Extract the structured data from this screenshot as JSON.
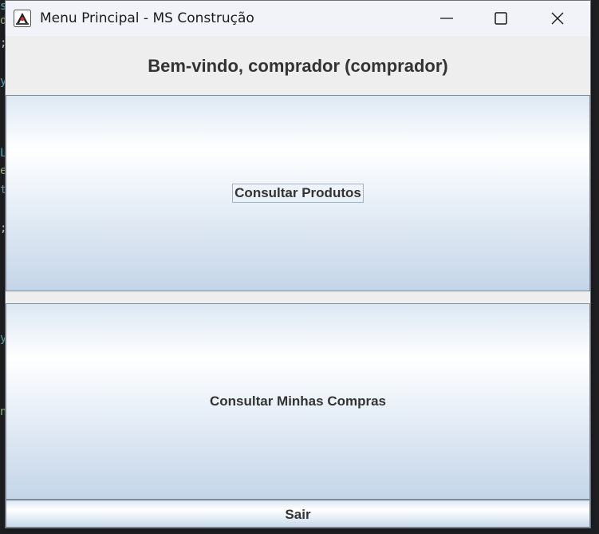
{
  "window": {
    "title": "Menu Principal - MS Construção",
    "app_icon": "java-duke-icon",
    "controls": [
      "minimize-icon",
      "maximize-icon",
      "close-icon"
    ]
  },
  "header": {
    "welcome_text": "Bem-vindo, comprador (comprador)"
  },
  "buttons": {
    "consultar_produtos": "Consultar Produtos",
    "consultar_compras": "Consultar Minhas Compras",
    "sair": "Sair"
  },
  "colors": {
    "button_gradient_top": "#ffffff",
    "button_gradient_bottom": "#c4d5e8",
    "text": "#333333",
    "titlebar": "#f2f3f9"
  }
}
